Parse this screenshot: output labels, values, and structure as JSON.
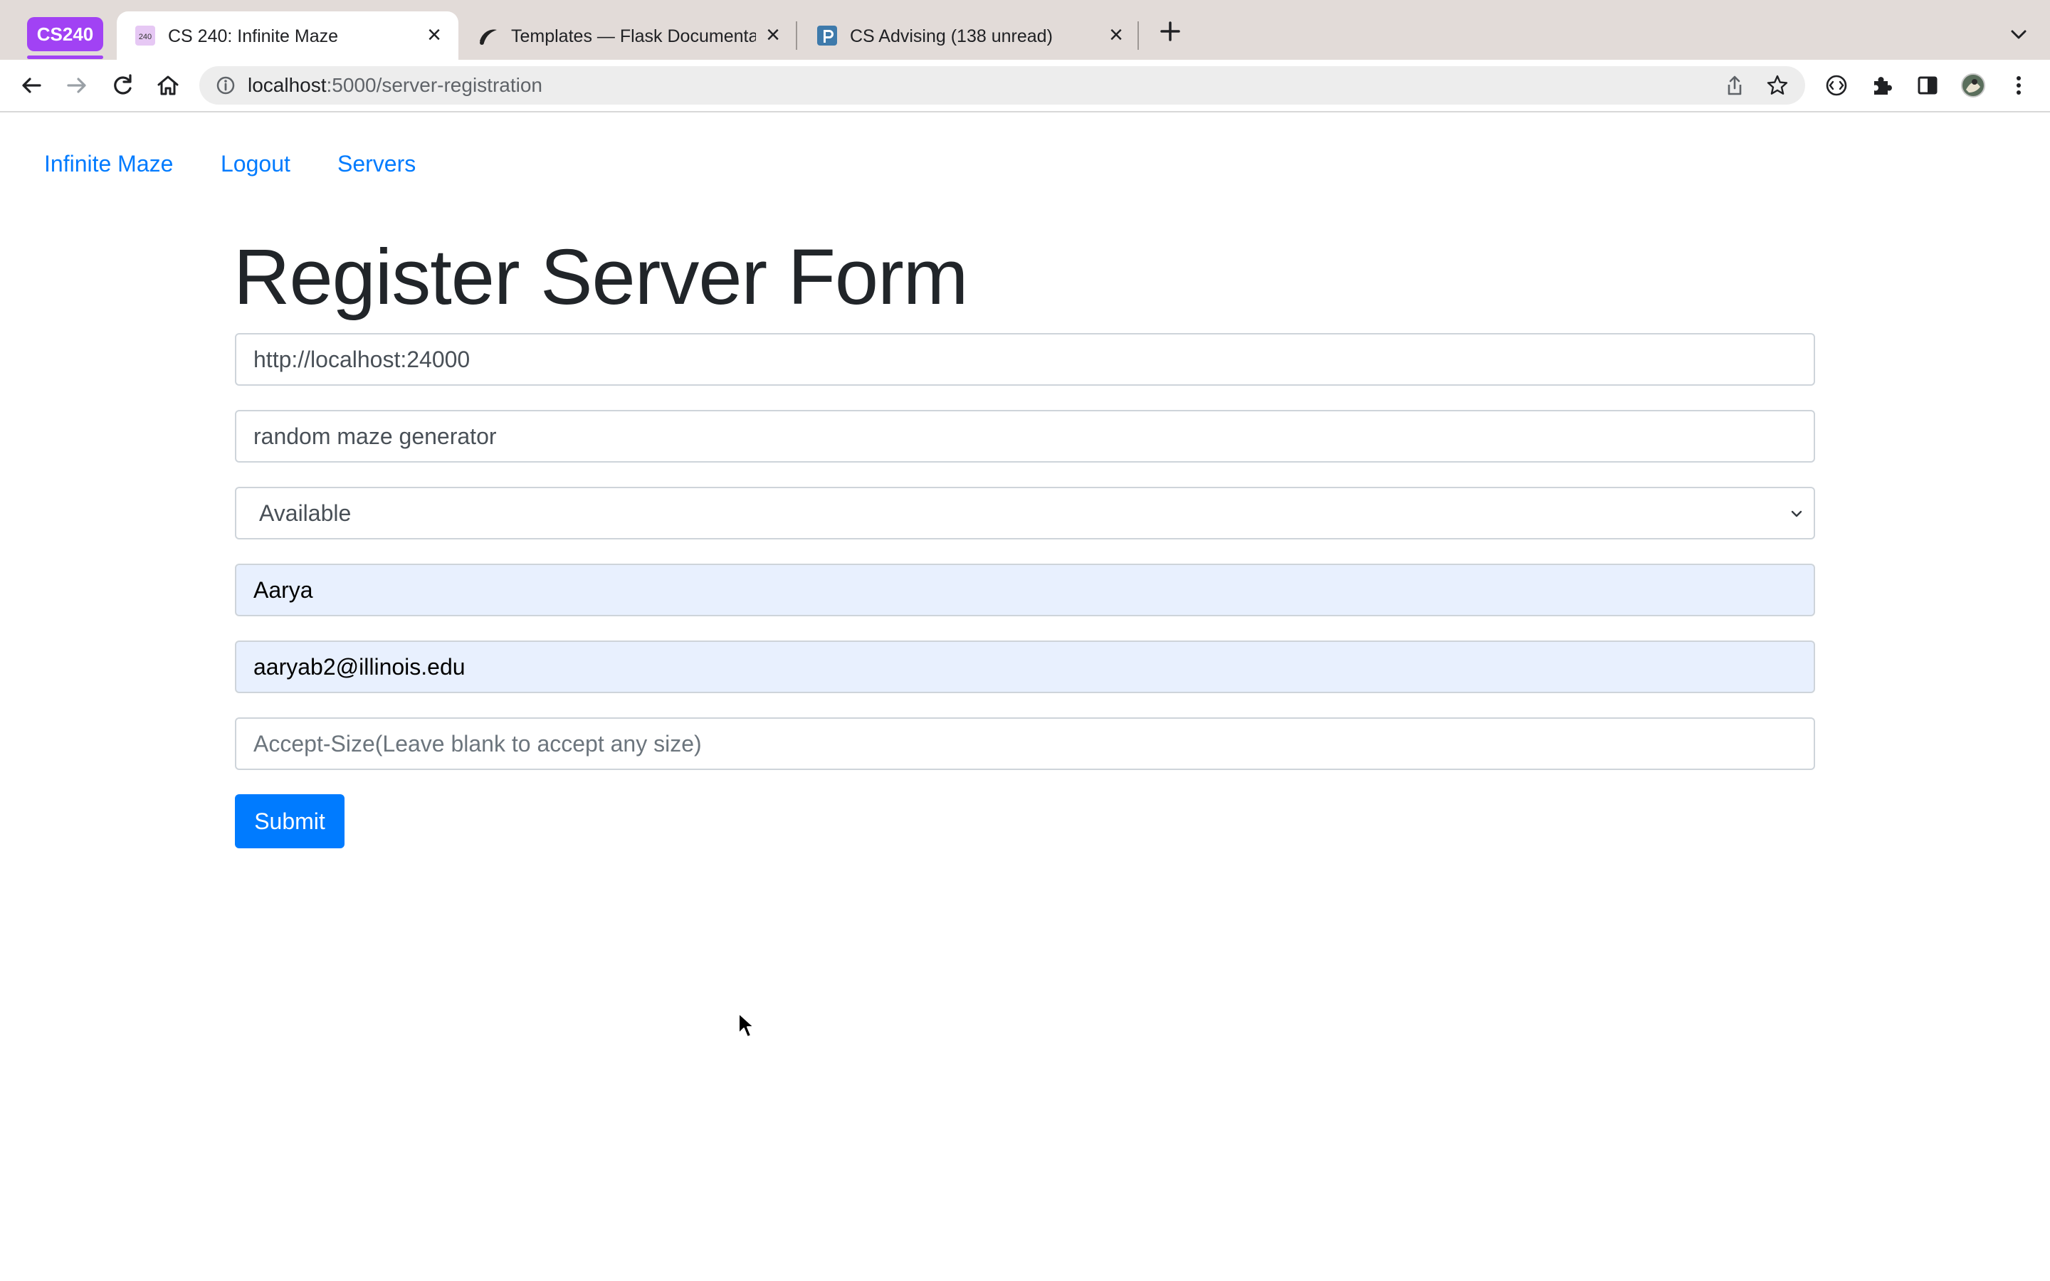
{
  "browser": {
    "tab_group_label": "CS240",
    "tabs": [
      {
        "title": "CS 240: Infinite Maze",
        "active": true
      },
      {
        "title": "Templates — Flask Documentat",
        "active": false
      },
      {
        "title": "CS Advising (138 unread)",
        "active": false
      }
    ],
    "url_host": "localhost",
    "url_rest": ":5000/server-registration"
  },
  "nav": {
    "links": [
      "Infinite Maze",
      "Logout",
      "Servers"
    ]
  },
  "form": {
    "title": "Register Server Form",
    "url_value": "http://localhost:24000",
    "author_value": "random maze generator",
    "status_selected": "Available",
    "name_value": "Aarya",
    "email_value": "aaryab2@illinois.edu",
    "accept_size_placeholder": "Accept-Size(Leave blank to accept any size)",
    "submit_label": "Submit"
  },
  "colors": {
    "link": "#007bff",
    "primary_button": "#007bff",
    "autofill_bg": "#e8f0fe",
    "tab_group": "#a142f4",
    "tabstrip_bg": "#e2dbd8"
  }
}
